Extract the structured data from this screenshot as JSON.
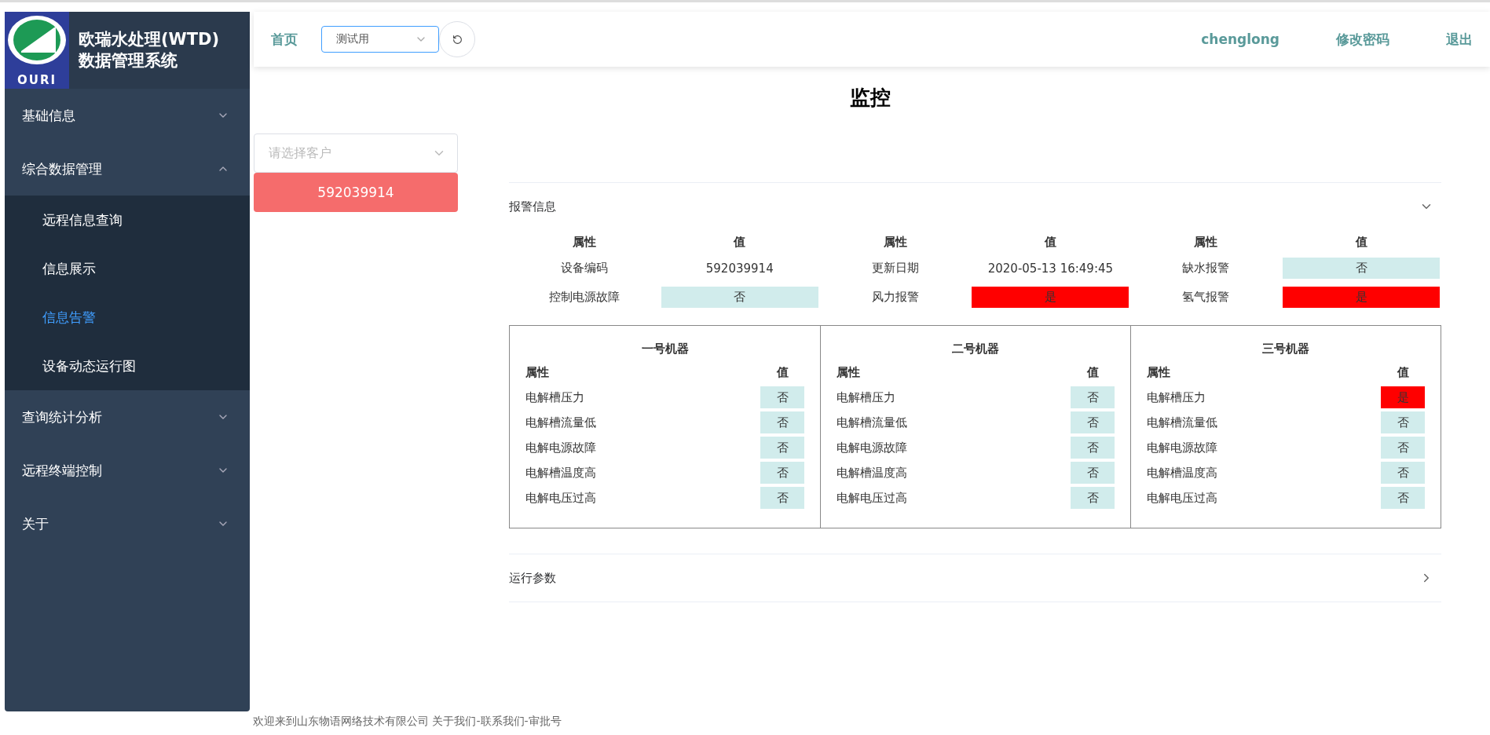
{
  "sidebar": {
    "logo_text": "OURI",
    "title": "欧瑞水处理(WTD)\n数据管理系统",
    "items": [
      {
        "label": "基础信息",
        "expanded": false
      },
      {
        "label": "综合数据管理",
        "expanded": true,
        "children": [
          {
            "label": "远程信息查询",
            "selected": false
          },
          {
            "label": "信息展示",
            "selected": false
          },
          {
            "label": "信息告警",
            "selected": true
          },
          {
            "label": "设备动态运行图",
            "selected": false
          }
        ]
      },
      {
        "label": "查询统计分析",
        "expanded": false
      },
      {
        "label": "远程终端控制",
        "expanded": false
      },
      {
        "label": "关于",
        "expanded": false
      }
    ]
  },
  "header": {
    "home": "首页",
    "site_select": "测试用",
    "user": "chenglong",
    "change_password": "修改密码",
    "logout": "退出"
  },
  "page_title": "监控",
  "customer_select": {
    "placeholder": "请选择客户"
  },
  "devices": [
    {
      "label": "592039914",
      "selected": true
    }
  ],
  "sections": [
    {
      "title": "报警信息",
      "expanded": true,
      "summary": {
        "columns": [
          "属性",
          "值",
          "属性",
          "值",
          "属性",
          "值"
        ],
        "rows": [
          [
            {
              "text": "设备编码"
            },
            {
              "text": "592039914"
            },
            {
              "text": "更新日期"
            },
            {
              "text": "2020-05-13 16:49:45"
            },
            {
              "text": "缺水报警"
            },
            {
              "text": "否",
              "alarm": false
            }
          ],
          [
            {
              "text": "控制电源故障"
            },
            {
              "text": "否",
              "alarm": false
            },
            {
              "text": "风力报警"
            },
            {
              "text": "是",
              "alarm": true
            },
            {
              "text": "氢气报警"
            },
            {
              "text": "是",
              "alarm": true
            }
          ]
        ]
      },
      "machines": [
        {
          "title": "一号机器",
          "columns": [
            "属性",
            "值"
          ],
          "rows": [
            {
              "name": "电解槽压力",
              "value": "否",
              "alarm": false
            },
            {
              "name": "电解槽流量低",
              "value": "否",
              "alarm": false
            },
            {
              "name": "电解电源故障",
              "value": "否",
              "alarm": false
            },
            {
              "name": "电解槽温度高",
              "value": "否",
              "alarm": false
            },
            {
              "name": "电解电压过高",
              "value": "否",
              "alarm": false
            }
          ]
        },
        {
          "title": "二号机器",
          "columns": [
            "属性",
            "值"
          ],
          "rows": [
            {
              "name": "电解槽压力",
              "value": "否",
              "alarm": false
            },
            {
              "name": "电解槽流量低",
              "value": "否",
              "alarm": false
            },
            {
              "name": "电解电源故障",
              "value": "否",
              "alarm": false
            },
            {
              "name": "电解槽温度高",
              "value": "否",
              "alarm": false
            },
            {
              "name": "电解电压过高",
              "value": "否",
              "alarm": false
            }
          ]
        },
        {
          "title": "三号机器",
          "columns": [
            "属性",
            "值"
          ],
          "rows": [
            {
              "name": "电解槽压力",
              "value": "是",
              "alarm": true
            },
            {
              "name": "电解槽流量低",
              "value": "否",
              "alarm": false
            },
            {
              "name": "电解电源故障",
              "value": "否",
              "alarm": false
            },
            {
              "name": "电解槽温度高",
              "value": "否",
              "alarm": false
            },
            {
              "name": "电解电压过高",
              "value": "否",
              "alarm": false
            }
          ]
        }
      ]
    },
    {
      "title": "运行参数",
      "expanded": false
    }
  ],
  "footer": "欢迎来到山东物语网络技术有限公司 关于我们-联系我们-审批号"
}
